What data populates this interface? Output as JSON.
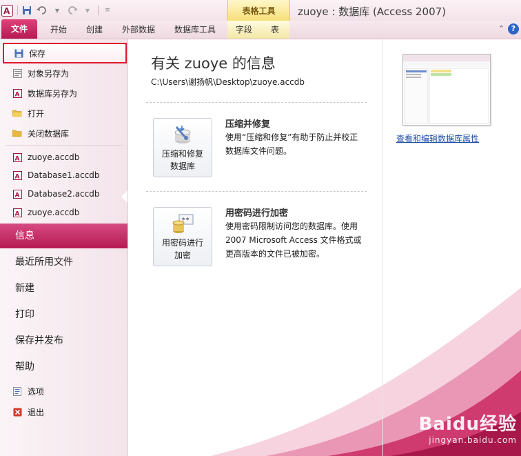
{
  "window": {
    "title": "zuoye : 数据库 (Access 2007)",
    "context_tab_group": "表格工具"
  },
  "ribbon": {
    "tabs": [
      "文件",
      "开始",
      "创建",
      "外部数据",
      "数据库工具",
      "字段",
      "表"
    ],
    "help_glyph": "?",
    "minimize_glyph": "⌃"
  },
  "sidebar": {
    "commands": [
      {
        "label": "保存",
        "icon": "save-icon"
      },
      {
        "label": "对象另存为",
        "icon": "save-as-icon"
      },
      {
        "label": "数据库另存为",
        "icon": "database-save-as-icon"
      },
      {
        "label": "打开",
        "icon": "open-folder-icon"
      },
      {
        "label": "关闭数据库",
        "icon": "close-database-icon"
      }
    ],
    "recent_files": [
      {
        "label": "zuoye.accdb",
        "icon": "access-file-icon"
      },
      {
        "label": "Database1.accdb",
        "icon": "access-file-icon"
      },
      {
        "label": "Database2.accdb",
        "icon": "access-file-icon"
      },
      {
        "label": "zuoye.accdb",
        "icon": "access-file-icon"
      }
    ],
    "nav_tabs": [
      "信息",
      "最近所用文件",
      "新建",
      "打印",
      "保存并发布",
      "帮助"
    ],
    "bottom_commands": [
      {
        "label": "选项",
        "icon": "options-icon"
      },
      {
        "label": "退出",
        "icon": "exit-icon"
      }
    ]
  },
  "main": {
    "title": "有关 zuoye 的信息",
    "file_path": "C:\\Users\\谢扬帆\\Desktop\\zuoye.accdb",
    "actions": [
      {
        "button_line1": "压缩和修复",
        "button_line2": "数据库",
        "heading": "压缩并修复",
        "description": "使用“压缩和修复”有助于防止并校正数据库文件问题。",
        "icon": "compact-repair-icon"
      },
      {
        "button_line1": "用密码进行",
        "button_line2": "加密",
        "heading": "用密码进行加密",
        "description": "使用密码限制访问您的数据库。使用 2007 Microsoft Access 文件格式或更高版本的文件已被加密。",
        "icon": "encrypt-password-icon"
      }
    ],
    "properties_link": "查看和编辑数据库属性"
  },
  "watermark": {
    "brand": "Baidu经验",
    "url": "jingyan.baidu.com"
  },
  "colors": {
    "accent": "#b51a52",
    "selected_outline": "#e0162d",
    "link": "#1f4fa8"
  }
}
